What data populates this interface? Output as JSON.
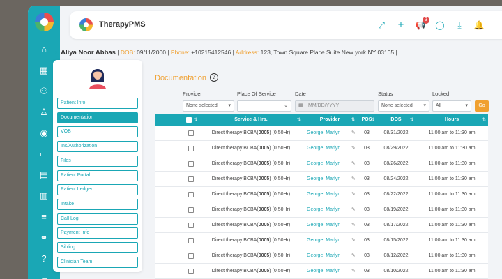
{
  "app": {
    "brand": "TherapyPMS",
    "notification_count": "3"
  },
  "patient": {
    "name": "Aliya Noor Abbas",
    "dob_label": "DOB:",
    "dob": "09/11/2000",
    "phone_label": "Phone:",
    "phone": "+10215412546",
    "address_label": "Address:",
    "address": "123, Town Square Place Suite New york NY 03105"
  },
  "sidebar_menu": [
    {
      "label": "Patient Info",
      "active": false
    },
    {
      "label": "Documentation",
      "active": true
    },
    {
      "label": "VOB",
      "active": false
    },
    {
      "label": "Ins/Authorization",
      "active": false
    },
    {
      "label": "Files",
      "active": false
    },
    {
      "label": "Patient Portal",
      "active": false
    },
    {
      "label": "Patient Ledger",
      "active": false
    },
    {
      "label": "Intake",
      "active": false
    },
    {
      "label": "Call Log",
      "active": false
    },
    {
      "label": "Payment Info",
      "active": false
    },
    {
      "label": "Sibling",
      "active": false
    },
    {
      "label": "Clinician Team",
      "active": false
    }
  ],
  "documentation": {
    "title": "Documentation",
    "filters": {
      "provider_label": "Provider",
      "provider_value": "None selected",
      "pos_label": "Place Of Service",
      "pos_value": "",
      "date_label": "Date",
      "date_placeholder": "MM/DD/YYYY",
      "status_label": "Status",
      "status_value": "None selected",
      "locked_label": "Locked",
      "locked_value": "All",
      "go_label": "Go"
    },
    "columns": [
      "Service & Hrs.",
      "Provider",
      "POS",
      "DOS",
      "Hours"
    ],
    "rows": [
      {
        "service": "Direct therapy BCBA(",
        "code": "0005",
        "suffix": ") (0.50Hr)",
        "provider": "George, Marlyn",
        "pos": "03",
        "dos": "08/31/2022",
        "hours": "11:00 am to 11:30 am"
      },
      {
        "service": "Direct therapy BCBA(",
        "code": "0005",
        "suffix": ") (0.50Hr)",
        "provider": "George, Marlyn",
        "pos": "03",
        "dos": "08/29/2022",
        "hours": "11:00 am to 11:30 am"
      },
      {
        "service": "Direct therapy BCBA(",
        "code": "0005",
        "suffix": ") (0.50Hr)",
        "provider": "George, Marlyn",
        "pos": "03",
        "dos": "08/26/2022",
        "hours": "11:00 am to 11:30 am"
      },
      {
        "service": "Direct therapy BCBA(",
        "code": "0005",
        "suffix": ") (0.50Hr)",
        "provider": "George, Marlyn",
        "pos": "03",
        "dos": "08/24/2022",
        "hours": "11:00 am to 11:30 am"
      },
      {
        "service": "Direct therapy BCBA(",
        "code": "0005",
        "suffix": ") (0.50Hr)",
        "provider": "George, Marlyn",
        "pos": "03",
        "dos": "08/22/2022",
        "hours": "11:00 am to 11:30 am"
      },
      {
        "service": "Direct therapy BCBA(",
        "code": "0005",
        "suffix": ") (0.50Hr)",
        "provider": "George, Marlyn",
        "pos": "03",
        "dos": "08/19/2022",
        "hours": "11:00 am to 11:30 am"
      },
      {
        "service": "Direct therapy BCBA(",
        "code": "0005",
        "suffix": ") (0.50Hr)",
        "provider": "George, Marlyn",
        "pos": "03",
        "dos": "08/17/2022",
        "hours": "11:00 am to 11:30 am"
      },
      {
        "service": "Direct therapy BCBA(",
        "code": "0005",
        "suffix": ") (0.50Hr)",
        "provider": "George, Marlyn",
        "pos": "03",
        "dos": "08/15/2022",
        "hours": "11:00 am to 11:30 am"
      },
      {
        "service": "Direct therapy BCBA(",
        "code": "0005",
        "suffix": ") (0.50Hr)",
        "provider": "George, Marlyn",
        "pos": "03",
        "dos": "08/12/2022",
        "hours": "11:00 am to 11:30 am"
      },
      {
        "service": "Direct therapy BCBA(",
        "code": "0005",
        "suffix": ") (0.50Hr)",
        "provider": "George, Marlyn",
        "pos": "03",
        "dos": "08/10/2022",
        "hours": "11:00 am to 11:30 am"
      }
    ]
  },
  "icons": {
    "rail": [
      "home-icon",
      "calendar-icon",
      "add-user-icon",
      "user-icon",
      "billing-icon",
      "card-icon",
      "document-icon",
      "chart-icon",
      "menu-icon",
      "network-icon",
      "help-icon",
      "book-icon"
    ],
    "topbar": [
      "fullscreen-icon",
      "plus-icon",
      "megaphone-icon",
      "chat-icon",
      "download-icon",
      "bell-icon"
    ]
  },
  "colors": {
    "accent": "#1aa7b5",
    "highlight": "#f0a030",
    "alert": "#e24a4a"
  }
}
